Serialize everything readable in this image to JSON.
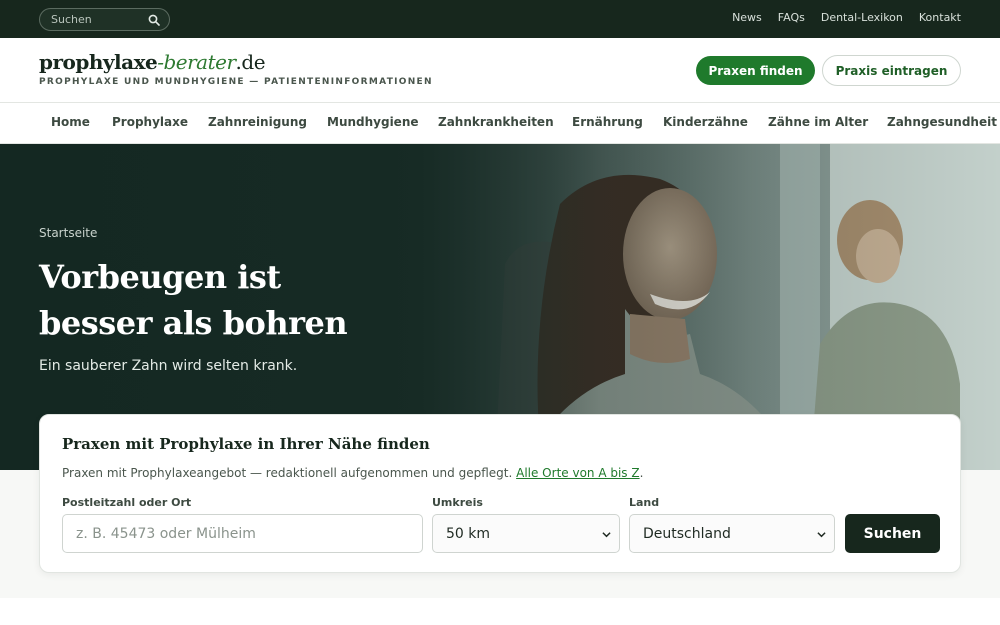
{
  "topbar": {
    "search_placeholder": "Suchen",
    "links": [
      "News",
      "FAQs",
      "Dental-Lexikon",
      "Kontakt"
    ]
  },
  "header": {
    "logo_part1": "prophylaxe",
    "logo_part2": "-berater",
    "logo_part3": ".de",
    "tagline": "PROPHYLAXE UND MUNDHYGIENE — PATIENTENINFORMATIONEN",
    "primary_button": "Praxen finden",
    "secondary_button": "Praxis eintragen"
  },
  "nav": {
    "items": [
      "Home",
      "Prophylaxe",
      "Zahnreinigung",
      "Mundhygiene",
      "Zahnkrankheiten",
      "Ernährung",
      "Kinderzähne",
      "Zähne im Alter",
      "Zahngesundheit"
    ]
  },
  "hero": {
    "breadcrumb": "Startseite",
    "headline_line1": "Vorbeugen ist",
    "headline_line2": "besser als bohren",
    "subtitle": "Ein sauberer Zahn wird selten krank."
  },
  "search_card": {
    "title": "Praxen mit Prophylaxe in Ihrer Nähe finden",
    "description": "Praxen mit Prophylaxeangebot — redaktionell aufgenommen und gepflegt.",
    "link_text": "Alle Orte von A bis Z",
    "link_suffix": ".",
    "location_label": "Postleitzahl oder Ort",
    "location_placeholder": "z. B. 45473 oder Mülheim",
    "radius_label": "Umkreis",
    "radius_value": "50 km",
    "country_label": "Land",
    "country_value": "Deutschland",
    "submit_label": "Suchen"
  },
  "colors": {
    "dark_green": "#17271d",
    "accent_green": "#1f7a2c",
    "link_green": "#1f7a2c"
  }
}
